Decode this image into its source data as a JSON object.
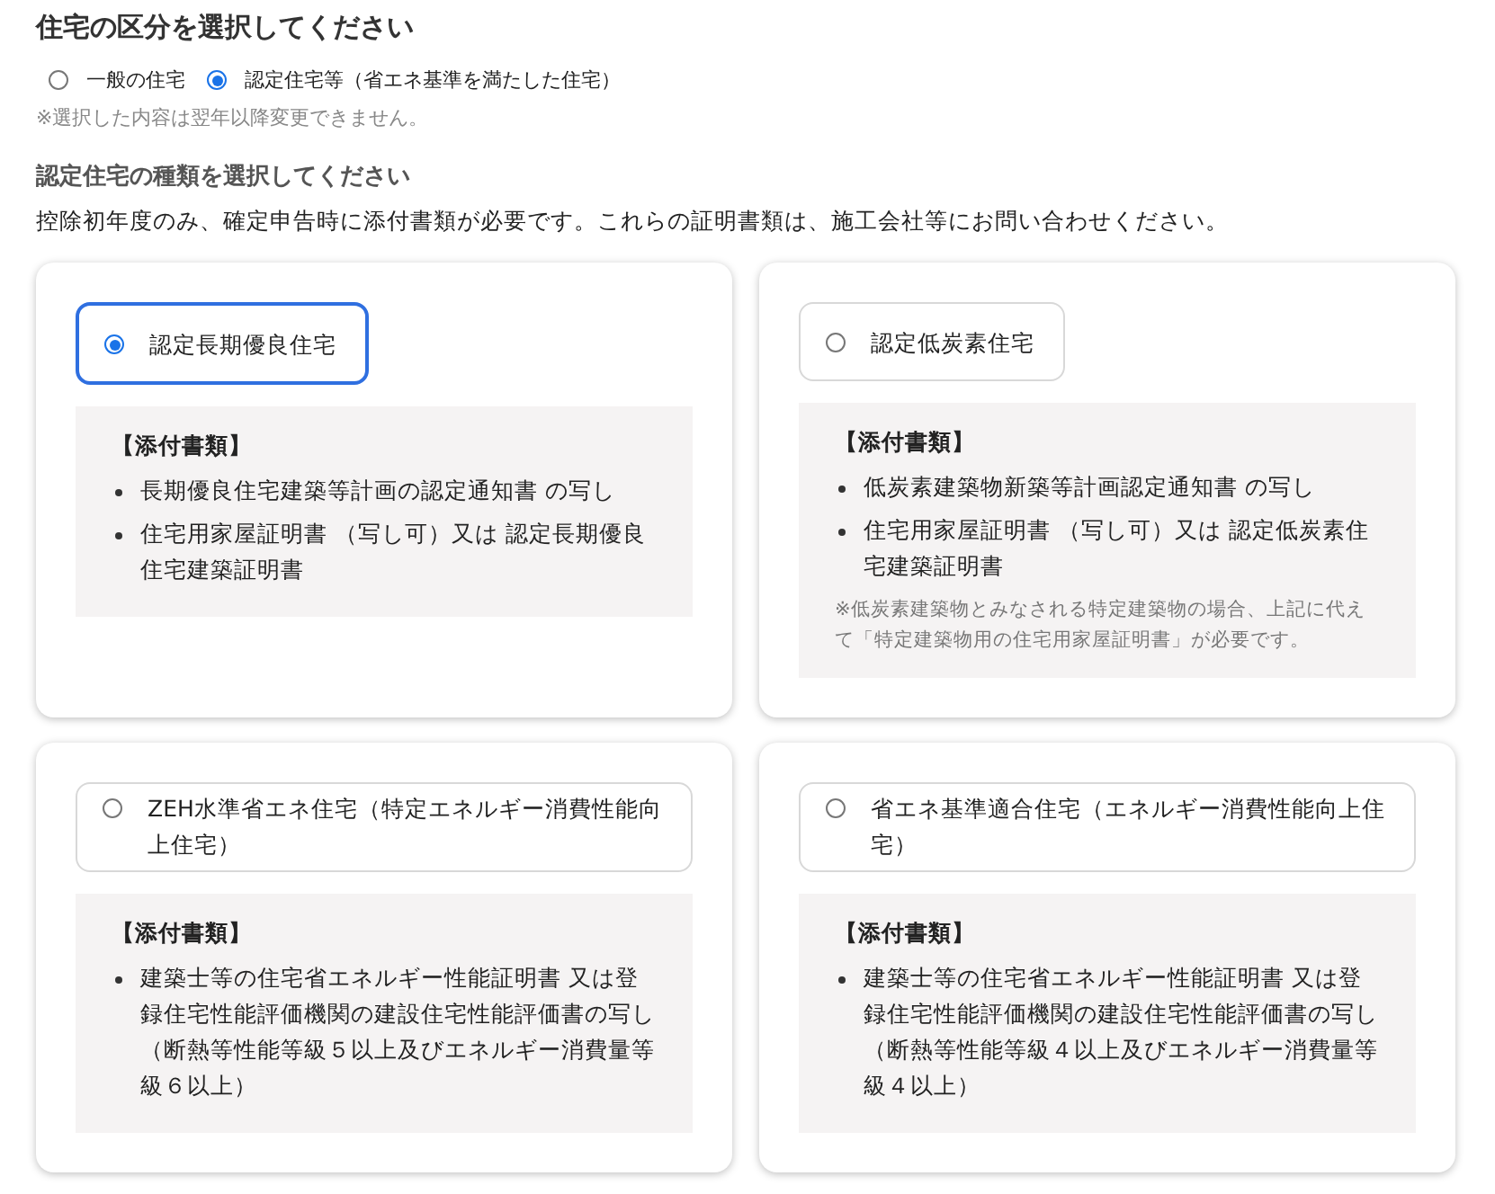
{
  "heading": "住宅の区分を選択してください",
  "housing_type": [
    {
      "label": "一般の住宅",
      "selected": false
    },
    {
      "label": "認定住宅等（省エネ基準を満たした住宅）",
      "selected": true
    }
  ],
  "housing_note": "※選択した内容は翌年以降変更できません。",
  "subheading": "認定住宅の種類を選択してください",
  "description": "控除初年度のみ、確定申告時に添付書類が必要です。これらの証明書類は、施工会社等にお問い合わせください。",
  "certified_types": [
    {
      "label": "認定長期優良住宅",
      "selected": true,
      "documents_title": "【添付書類】",
      "documents": [
        "長期優良住宅建築等計画の認定通知書 の写し",
        "住宅用家屋証明書 （写し可）又は 認定長期優良住宅建築証明書"
      ]
    },
    {
      "label": "認定低炭素住宅",
      "selected": false,
      "documents_title": "【添付書類】",
      "documents": [
        "低炭素建築物新築等計画認定通知書 の写し",
        "住宅用家屋証明書 （写し可）又は 認定低炭素住宅建築証明書"
      ],
      "note": "※低炭素建築物とみなされる特定建築物の場合、上記に代えて「特定建築物用の住宅用家屋証明書」が必要です。"
    },
    {
      "label": "ZEH水準省エネ住宅（特定エネルギー消費性能向上住宅）",
      "selected": false,
      "documents_title": "【添付書類】",
      "documents": [
        "建築士等の住宅省エネルギー性能証明書 又は登録住宅性能評価機関の建設住宅性能評価書の写し（断熱等性能等級５以上及びエネルギー消費量等級６以上）"
      ]
    },
    {
      "label": "省エネ基準適合住宅（エネルギー消費性能向上住宅）",
      "selected": false,
      "documents_title": "【添付書類】",
      "documents": [
        "建築士等の住宅省エネルギー性能証明書 又は登録住宅性能評価機関の建設住宅性能評価書の写し（断熱等性能等級４以上及びエネルギー消費量等級４以上）"
      ]
    }
  ]
}
